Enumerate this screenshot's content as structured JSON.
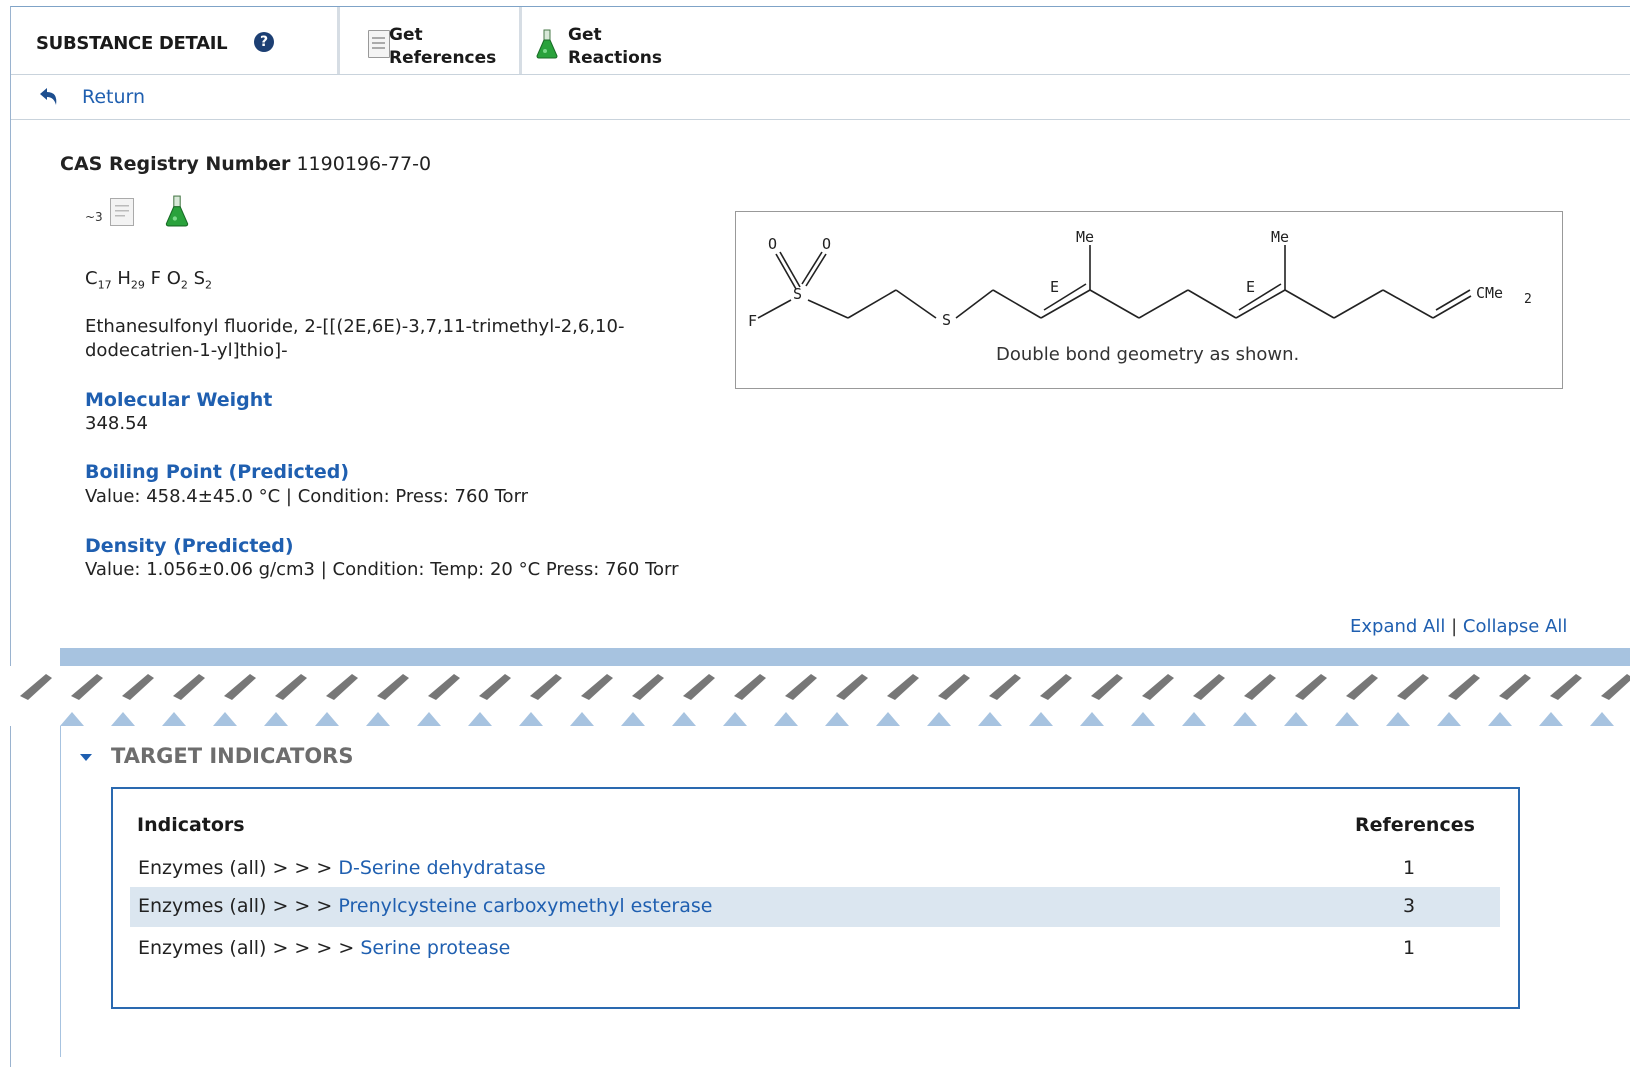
{
  "header": {
    "title": "SUBSTANCE DETAIL",
    "buttons": [
      {
        "line1": "Get",
        "line2": "References"
      },
      {
        "line1": "Get",
        "line2": "Reactions"
      }
    ]
  },
  "return_label": "Return",
  "substance": {
    "cas_label": "CAS Registry Number",
    "cas_number": "1190196-77-0",
    "reference_count": "~3",
    "formula": [
      {
        "el": "C",
        "n": "17"
      },
      {
        "el": "H",
        "n": "29"
      },
      {
        "el": "F",
        "n": ""
      },
      {
        "el": "O",
        "n": "2"
      },
      {
        "el": "S",
        "n": "2"
      }
    ],
    "name_line1": "Ethanesulfonyl fluoride, 2-[[(2E,6E)-3,7,11-trimethyl-2,6,10-",
    "name_line2": "dodecatrien-1-yl]thio]-",
    "structure_caption": "Double bond geometry as shown.",
    "structure_labels": {
      "me": "Me",
      "e": "E",
      "o": "O",
      "s": "S",
      "f": "F",
      "cme": "CMe",
      "cme_sub": "2"
    }
  },
  "properties": [
    {
      "title": "Molecular Weight",
      "value": "348.54"
    },
    {
      "title": "Boiling Point (Predicted)",
      "value": "Value: 458.4±45.0 °C | Condition: Press: 760 Torr"
    },
    {
      "title": "Density (Predicted)",
      "value": "Value: 1.056±0.06 g/cm3 | Condition: Temp: 20 °C Press: 760 Torr"
    }
  ],
  "expand_all": "Expand All",
  "collapse_all": "Collapse All",
  "target_indicators": {
    "title": "TARGET INDICATORS",
    "col_indicators": "Indicators",
    "col_references": "References",
    "rows": [
      {
        "path": "Enzymes (all) > > > ",
        "link": "D-Serine dehydratase",
        "refs": "1"
      },
      {
        "path": "Enzymes (all) > > > ",
        "link": "Prenylcysteine carboxymethyl esterase",
        "refs": "3"
      },
      {
        "path": "Enzymes (all) > > > > ",
        "link": "Serine protease",
        "refs": "1"
      }
    ]
  }
}
